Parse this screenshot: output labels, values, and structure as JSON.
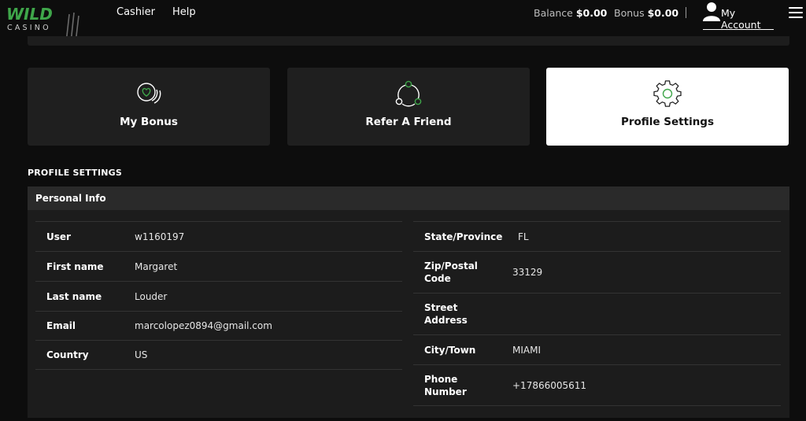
{
  "brand": {
    "wild": "WILD",
    "casino": "CASINO"
  },
  "nav": {
    "cashier": "Cashier",
    "help": "Help"
  },
  "balances": {
    "balance_label": "Balance",
    "balance_value": "$0.00",
    "bonus_label": "Bonus",
    "bonus_value": "$0.00"
  },
  "account": {
    "label": "My Account"
  },
  "cards": [
    {
      "label": "My Bonus",
      "icon": "bonus-coin-icon"
    },
    {
      "label": "Refer A Friend",
      "icon": "share-network-icon"
    },
    {
      "label": "Profile Settings",
      "icon": "gear-icon"
    }
  ],
  "section_title": "PROFILE SETTINGS",
  "panel_title": "Personal Info",
  "left_fields": [
    {
      "key": "User",
      "value": "w1160197"
    },
    {
      "key": "First name",
      "value": "Margaret"
    },
    {
      "key": "Last name",
      "value": "Louder"
    },
    {
      "key": "Email",
      "value": "marcolopez0894@gmail.com"
    },
    {
      "key": "Country",
      "value": "US"
    }
  ],
  "right_fields": [
    {
      "key": "State/Province",
      "value": "FL"
    },
    {
      "key": "Zip/Postal Code",
      "value": "33129"
    },
    {
      "key": "Street Address",
      "value": ""
    },
    {
      "key": "City/Town",
      "value": "MIAMI"
    },
    {
      "key": "Phone Number",
      "value": "+17866005611"
    }
  ],
  "colors": {
    "accent": "#3fa64a",
    "background": "#0d0d0d",
    "card": "#1f1f1f",
    "active_card": "#ffffff"
  }
}
